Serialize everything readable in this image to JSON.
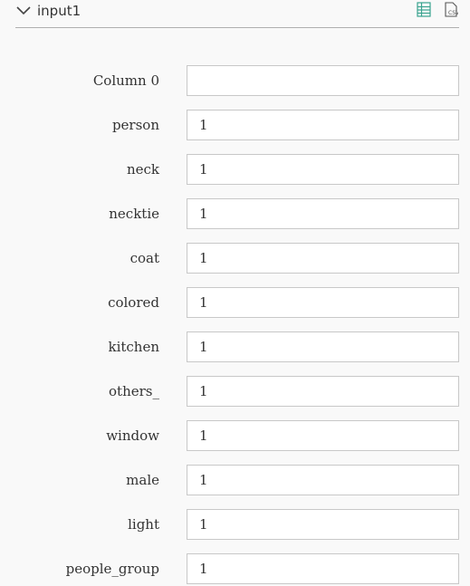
{
  "header": {
    "title": "input1",
    "collapse_icon": "chevron-down-icon",
    "table_view_icon": "table-view-icon",
    "csv_icon": "csv-file-icon",
    "accent_color": "#3aa38f"
  },
  "fields": [
    {
      "label": "Column 0",
      "value": ""
    },
    {
      "label": "person",
      "value": "1"
    },
    {
      "label": "neck",
      "value": "1"
    },
    {
      "label": "necktie",
      "value": "1"
    },
    {
      "label": "coat",
      "value": "1"
    },
    {
      "label": "colored",
      "value": "1"
    },
    {
      "label": "kitchen",
      "value": "1"
    },
    {
      "label": "others_",
      "value": "1"
    },
    {
      "label": "window",
      "value": "1"
    },
    {
      "label": "male",
      "value": "1"
    },
    {
      "label": "light",
      "value": "1"
    },
    {
      "label": "people_group",
      "value": "1"
    }
  ]
}
